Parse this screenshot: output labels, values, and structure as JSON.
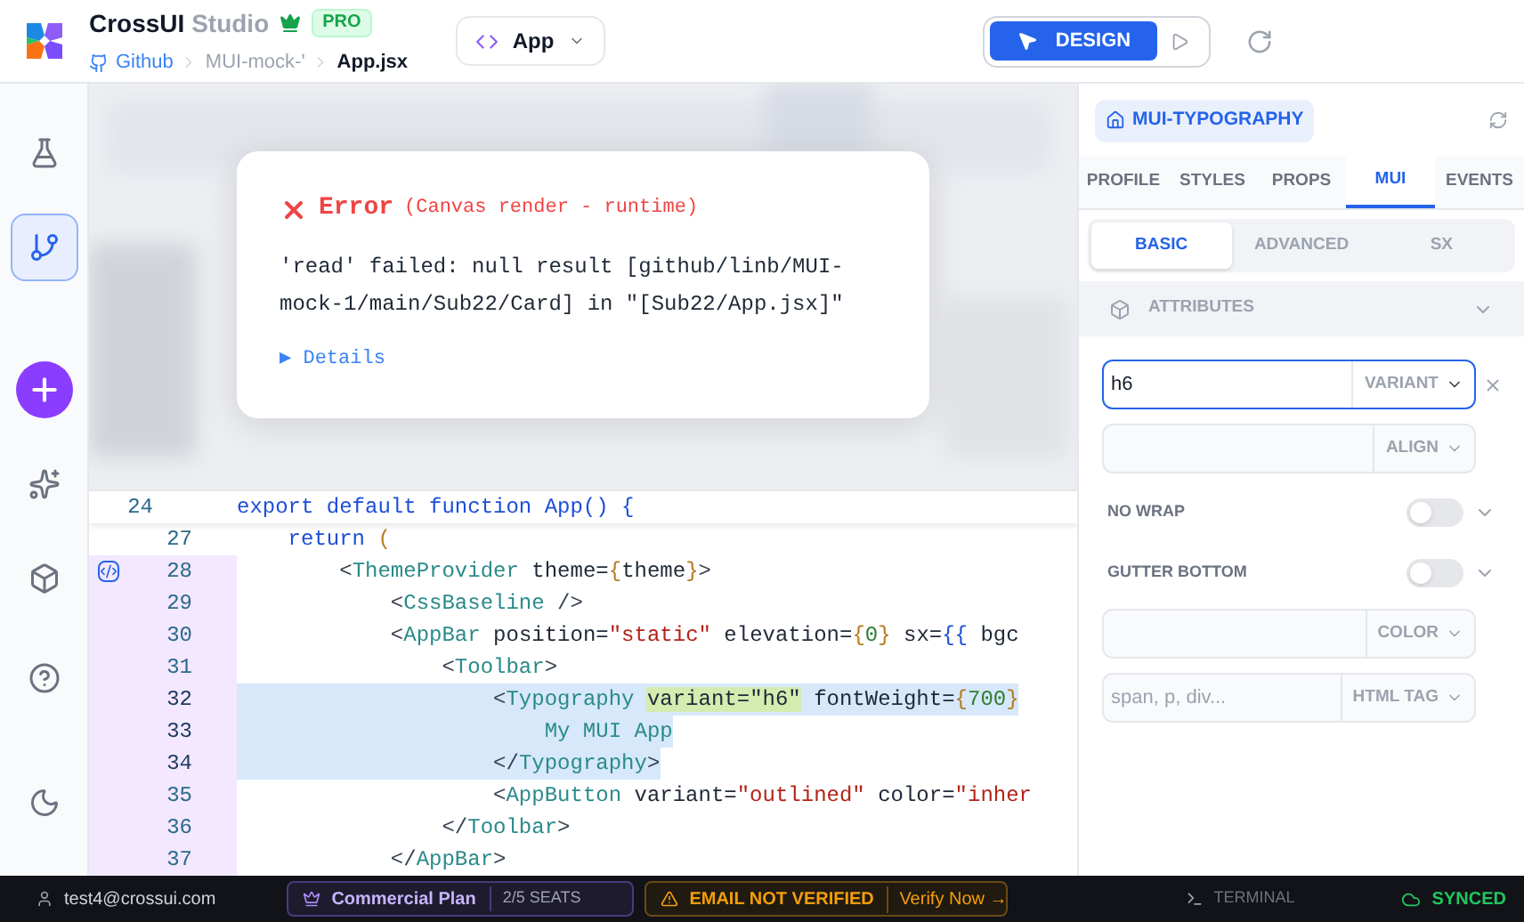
{
  "header": {
    "brand": "CrossUI",
    "brand_suffix": "Studio",
    "badge": "PRO",
    "breadcrumb": [
      {
        "label": "Github",
        "kind": "repo"
      },
      {
        "label": "MUI-mock-'",
        "kind": "folder"
      },
      {
        "label": "App.jsx",
        "kind": "file"
      }
    ],
    "component_picker": {
      "value": "App"
    },
    "modes": [
      {
        "kind": "design",
        "label": "DESIGN",
        "selected": true
      },
      {
        "kind": "preview",
        "selected": false
      }
    ]
  },
  "rail": [
    {
      "kind": "flask",
      "selected": false
    },
    {
      "kind": "branch",
      "selected": true
    },
    {
      "kind": "add",
      "selected": false
    },
    {
      "kind": "sparkles",
      "selected": false
    },
    {
      "kind": "box",
      "selected": false
    },
    {
      "kind": "help",
      "selected": false
    },
    {
      "kind": "moon",
      "selected": false
    }
  ],
  "error": {
    "title": "Error",
    "context": "(Canvas render - runtime)",
    "message": "'read' failed: null result [github/linb/MUI-mock-1/main/Sub22/Card] in \"[Sub22/App.jsx]\"",
    "details": "▶ Details"
  },
  "editor": {
    "sticky": {
      "number": "24",
      "tokens": [
        {
          "text": "export default function App() {",
          "kind": "keyword"
        }
      ]
    },
    "lines": [
      {
        "number": "27",
        "modified": false,
        "selected": false,
        "gutter_icon": false,
        "tokens": [
          {
            "text": "    return ",
            "kind": "keyword"
          },
          {
            "text": "(",
            "kind": "brace"
          }
        ]
      },
      {
        "number": "28",
        "modified": true,
        "selected": false,
        "gutter_icon": true,
        "tokens": [
          {
            "text": "        <",
            "kind": "punct"
          },
          {
            "text": "ThemeProvider",
            "kind": "tag"
          },
          {
            "text": " theme=",
            "kind": "attr"
          },
          {
            "text": "{",
            "kind": "brace"
          },
          {
            "text": "theme",
            "kind": "attr"
          },
          {
            "text": "}",
            "kind": "brace"
          },
          {
            "text": ">",
            "kind": "punct"
          }
        ]
      },
      {
        "number": "29",
        "modified": true,
        "selected": false,
        "gutter_icon": false,
        "tokens": [
          {
            "text": "            <",
            "kind": "punct"
          },
          {
            "text": "CssBaseline",
            "kind": "tag"
          },
          {
            "text": " />",
            "kind": "punct"
          }
        ]
      },
      {
        "number": "30",
        "modified": true,
        "selected": false,
        "gutter_icon": false,
        "tokens": [
          {
            "text": "            <",
            "kind": "punct"
          },
          {
            "text": "AppBar",
            "kind": "tag"
          },
          {
            "text": " position=",
            "kind": "attr"
          },
          {
            "text": "\"static\"",
            "kind": "string"
          },
          {
            "text": " elevation=",
            "kind": "attr"
          },
          {
            "text": "{",
            "kind": "brace"
          },
          {
            "text": "0",
            "kind": "number"
          },
          {
            "text": "}",
            "kind": "brace"
          },
          {
            "text": " sx=",
            "kind": "attr"
          },
          {
            "text": "{{",
            "kind": "keyword"
          },
          {
            "text": " bgc",
            "kind": "attr"
          }
        ]
      },
      {
        "number": "31",
        "modified": true,
        "selected": false,
        "gutter_icon": false,
        "tokens": [
          {
            "text": "                <",
            "kind": "punct"
          },
          {
            "text": "Toolbar",
            "kind": "tag"
          },
          {
            "text": ">",
            "kind": "punct"
          }
        ]
      },
      {
        "number": "32",
        "modified": true,
        "selected": true,
        "gutter_icon": false,
        "tokens": [
          {
            "text": "                    <",
            "kind": "punct"
          },
          {
            "text": "Typography ",
            "kind": "tag"
          },
          {
            "text": "variant=\"h6\"",
            "kind": "match"
          },
          {
            "text": " fontWeight=",
            "kind": "attr"
          },
          {
            "text": "{",
            "kind": "brace"
          },
          {
            "text": "700",
            "kind": "number"
          },
          {
            "text": "}",
            "kind": "brace"
          }
        ]
      },
      {
        "number": "33",
        "modified": true,
        "selected": true,
        "gutter_icon": false,
        "tokens": [
          {
            "text": "                        My MUI App",
            "kind": "tag"
          }
        ]
      },
      {
        "number": "34",
        "modified": true,
        "selected": true,
        "gutter_icon": false,
        "tokens": [
          {
            "text": "                    </",
            "kind": "punct"
          },
          {
            "text": "Typography",
            "kind": "tag"
          },
          {
            "text": ">",
            "kind": "punct"
          }
        ]
      },
      {
        "number": "35",
        "modified": true,
        "selected": false,
        "gutter_icon": false,
        "tokens": [
          {
            "text": "                    <",
            "kind": "punct"
          },
          {
            "text": "AppButton",
            "kind": "tag"
          },
          {
            "text": " variant=",
            "kind": "attr"
          },
          {
            "text": "\"outlined\"",
            "kind": "string"
          },
          {
            "text": " color=",
            "kind": "attr"
          },
          {
            "text": "\"inher",
            "kind": "string"
          }
        ]
      },
      {
        "number": "36",
        "modified": true,
        "selected": false,
        "gutter_icon": false,
        "tokens": [
          {
            "text": "                </",
            "kind": "punct"
          },
          {
            "text": "Toolbar",
            "kind": "tag"
          },
          {
            "text": ">",
            "kind": "punct"
          }
        ]
      },
      {
        "number": "37",
        "modified": true,
        "selected": false,
        "gutter_icon": false,
        "tokens": [
          {
            "text": "            </",
            "kind": "punct"
          },
          {
            "text": "AppBar",
            "kind": "tag"
          },
          {
            "text": ">",
            "kind": "punct"
          }
        ]
      }
    ]
  },
  "inspector": {
    "component": "MUI-TYPOGRAPHY",
    "tabs": [
      {
        "label": "PROFILE",
        "selected": false
      },
      {
        "label": "STYLES",
        "selected": false
      },
      {
        "label": "PROPS",
        "selected": false
      },
      {
        "label": "MUI",
        "selected": true
      },
      {
        "label": "EVENTS",
        "selected": false
      }
    ],
    "subtabs": [
      {
        "label": "BASIC",
        "selected": true
      },
      {
        "label": "ADVANCED",
        "selected": false
      },
      {
        "label": "SX",
        "selected": false
      }
    ],
    "section": {
      "title": "ATTRIBUTES",
      "expanded": true
    },
    "fields": [
      {
        "kind": "select",
        "label": "VARIANT",
        "value": "h6",
        "focused": true,
        "clearable": true
      },
      {
        "kind": "select",
        "label": "ALIGN",
        "focused": false,
        "clearable": false
      },
      {
        "kind": "switch",
        "label": "NO WRAP",
        "on": false
      },
      {
        "kind": "switch",
        "label": "GUTTER BOTTOM",
        "on": false
      },
      {
        "kind": "select",
        "label": "COLOR",
        "focused": false,
        "clearable": false
      },
      {
        "kind": "select",
        "label": "HTML TAG",
        "placeholder": "span, p, div...",
        "focused": false,
        "clearable": false
      }
    ]
  },
  "status_bar": {
    "user": "test4@crossui.com",
    "plan": "Commercial Plan",
    "seats": "2/5 SEATS",
    "warning": "EMAIL NOT VERIFIED",
    "verify": "Verify Now →",
    "terminal": "TERMINAL",
    "sync": "SYNCED"
  }
}
